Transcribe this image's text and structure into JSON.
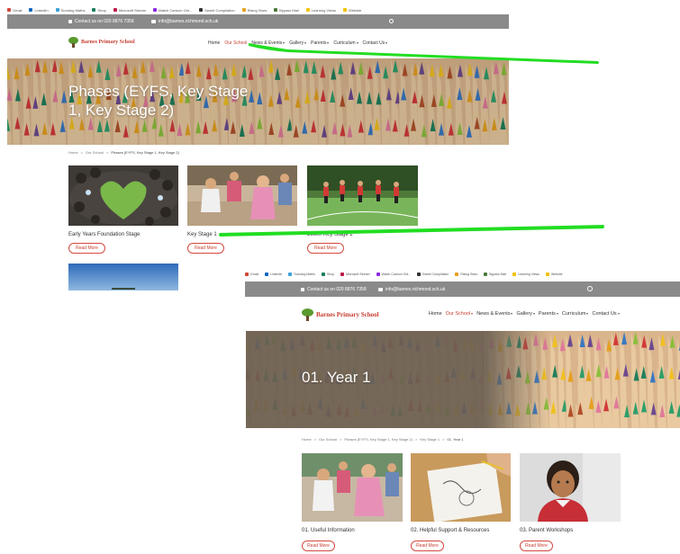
{
  "bookmarks": [
    {
      "label": "Gmail",
      "color": "#d44638"
    },
    {
      "label": "LinkedIn",
      "color": "#0a66c2"
    },
    {
      "label": "Sumdog Maths",
      "color": "#3aa0d9"
    },
    {
      "label": "Shop",
      "color": "#1a7f5a"
    },
    {
      "label": "Microsoft Stream",
      "color": "#bc1948"
    },
    {
      "label": "Watch Cartoon Onl...",
      "color": "#8a2be2"
    },
    {
      "label": "Sweet Compilation",
      "color": "#333333"
    },
    {
      "label": "Rising Stars",
      "color": "#e8a020"
    },
    {
      "label": "Bypass Mail",
      "color": "#4a7a3a"
    },
    {
      "label": "Learning Views",
      "color": "#f2c200"
    },
    {
      "label": "Website",
      "color": "#f2c200"
    }
  ],
  "page1": {
    "topbar": {
      "phone": "Contact us on  020 8876 7358",
      "email": "info@barnes.richmond.sch.uk"
    },
    "logo": "Barnes Primary School",
    "nav": [
      {
        "label": "Home",
        "dropdown": false,
        "active": false
      },
      {
        "label": "Our School",
        "dropdown": false,
        "active": true
      },
      {
        "label": "News & Events",
        "dropdown": true,
        "active": false
      },
      {
        "label": "Gallery",
        "dropdown": true,
        "active": false
      },
      {
        "label": "Parents",
        "dropdown": true,
        "active": false
      },
      {
        "label": "Curriculum",
        "dropdown": true,
        "active": false
      },
      {
        "label": "Contact Us",
        "dropdown": true,
        "active": false
      }
    ],
    "hero_title": "Phases (EYFS, Key Stage 1, Key Stage 2)",
    "breadcrumb": [
      "Home",
      "Our School",
      "Phases (EYFS, Key Stage 1, Key Stage 2)"
    ],
    "cards": [
      {
        "title": "Early Years Foundation Stage",
        "button": "Read More"
      },
      {
        "title": "Key Stage 1",
        "button": "Read More"
      },
      {
        "title": "Lower Key Stage 2",
        "button": "Read More"
      }
    ]
  },
  "page2": {
    "bookmarks": [
      "Gmail",
      "LinkedIn",
      "Sumdog Maths",
      "Shop",
      "Microsoft Stream",
      "Watch Cartoon Onl...",
      "Sweet Compilation",
      "Rising Stars",
      "Bypass Mail",
      "Learning Views",
      "Website"
    ],
    "topbar": {
      "phone": "Contact us on  020 8876 7358",
      "email": "info@barnes.richmond.sch.uk"
    },
    "logo": "Barnes Primary School",
    "nav": [
      {
        "label": "Home",
        "dropdown": false,
        "active": false
      },
      {
        "label": "Our School",
        "dropdown": true,
        "active": true
      },
      {
        "label": "News & Events",
        "dropdown": true,
        "active": false
      },
      {
        "label": "Gallery",
        "dropdown": true,
        "active": false
      },
      {
        "label": "Parents",
        "dropdown": true,
        "active": false
      },
      {
        "label": "Curriculum",
        "dropdown": true,
        "active": false
      },
      {
        "label": "Contact Us",
        "dropdown": true,
        "active": false
      }
    ],
    "hero_title": "01. Year 1",
    "breadcrumb": [
      "Home",
      "Our School",
      "Phases (EYFS, Key Stage 1, Key Stage 2)",
      "Key Stage 1",
      "01. Year 1"
    ],
    "cards": [
      {
        "title": "01. Useful Information",
        "button": "Read More"
      },
      {
        "title": "02. Helpful Support & Resources",
        "button": "Read More"
      },
      {
        "title": "03. Parent Workshops",
        "button": "Read More"
      }
    ]
  },
  "colors": {
    "accent": "#c63d2f",
    "topbar": "#8a8a8a",
    "annotation": "#22dd22"
  }
}
